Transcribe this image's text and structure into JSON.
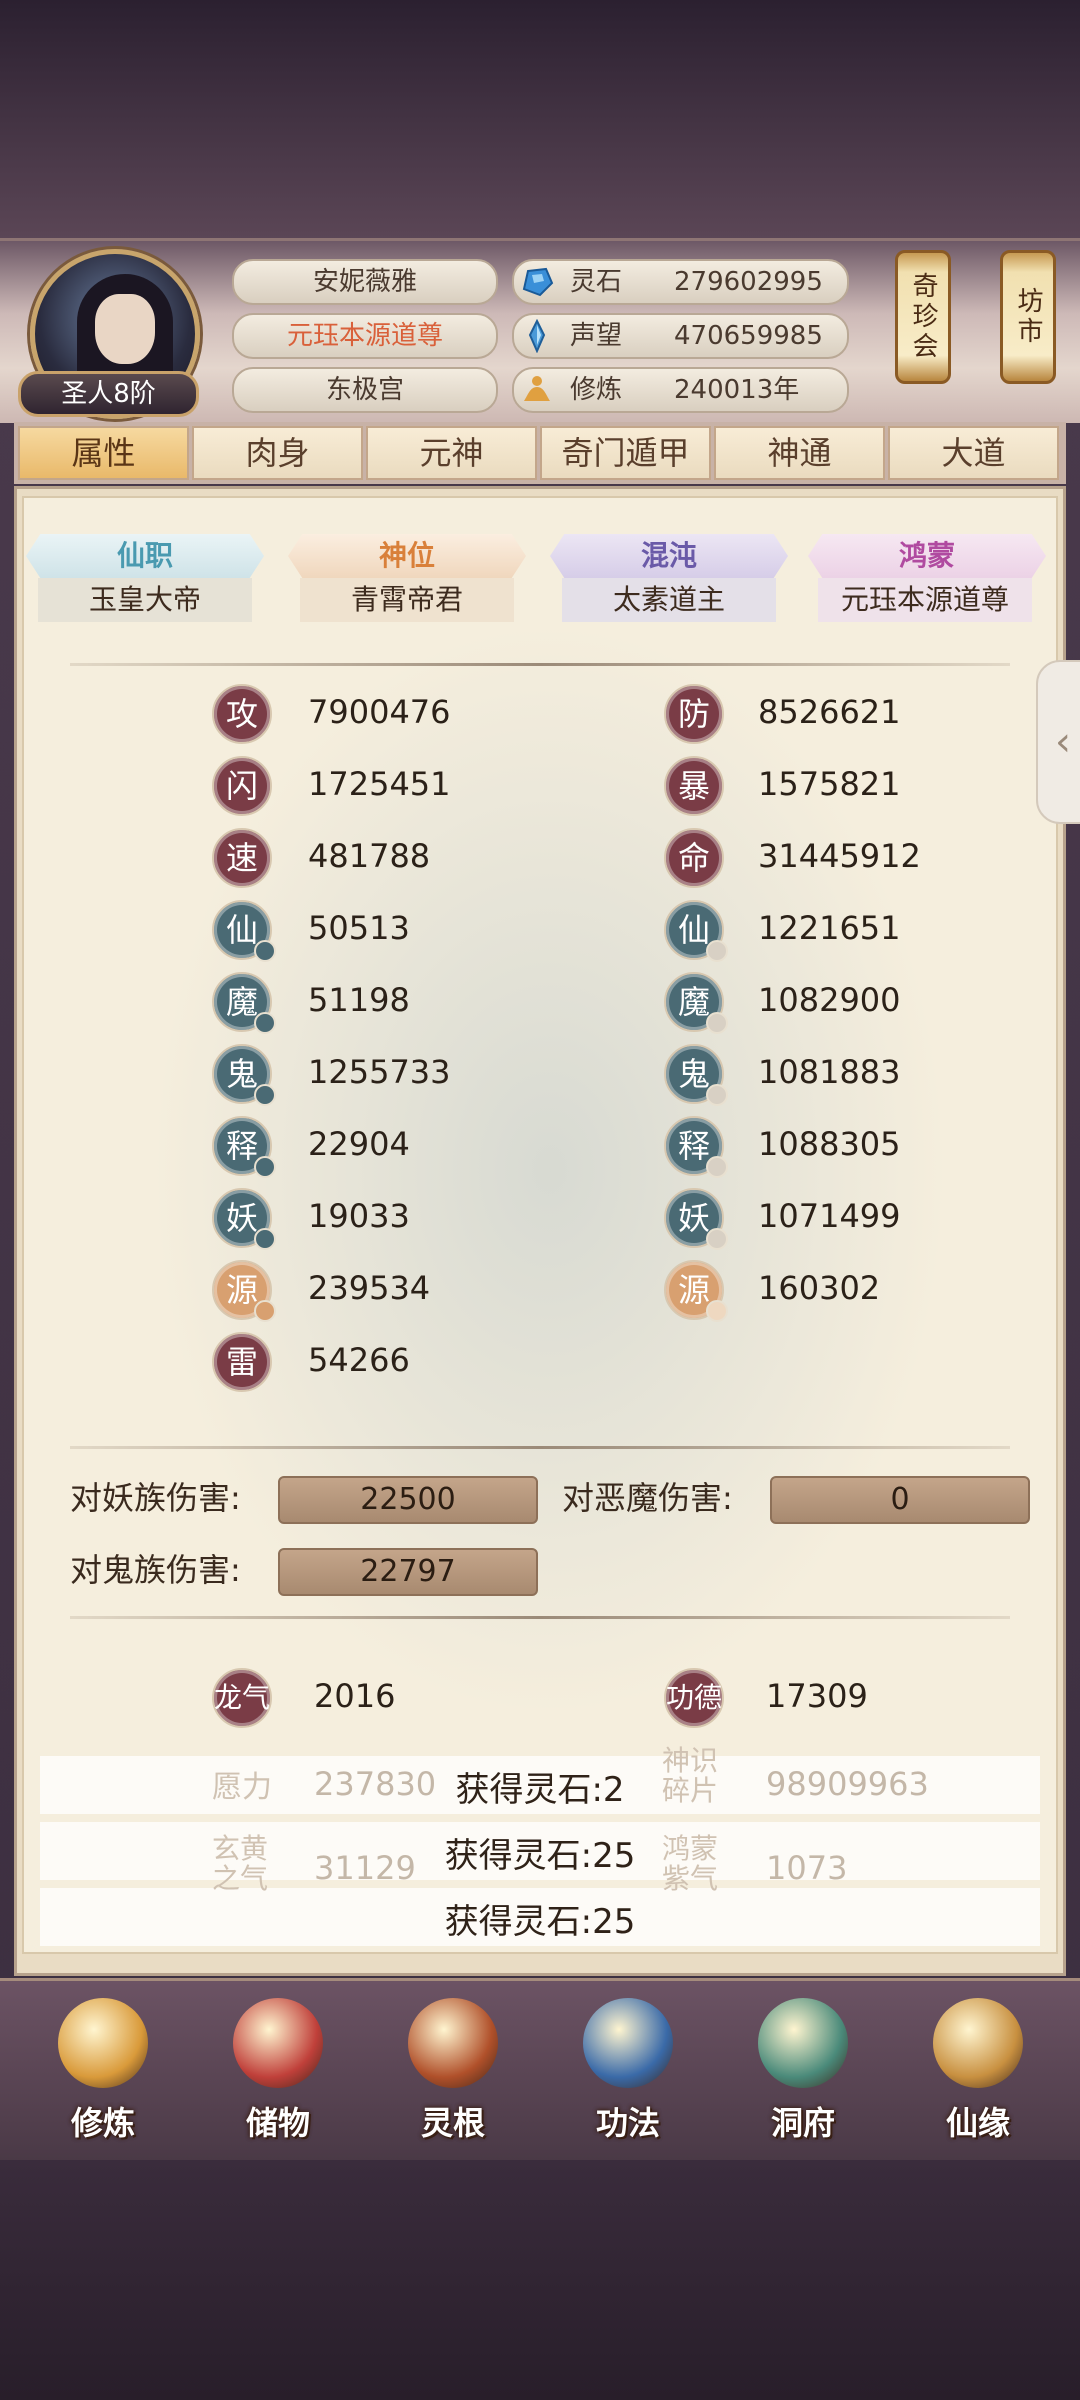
{
  "player": {
    "rank": "圣人8阶",
    "name": "安妮薇雅",
    "title": "元珏本源道尊",
    "palace": "东极宫"
  },
  "resources": [
    {
      "label": "灵石",
      "value": "279602995",
      "icon": "spirit-stone-icon",
      "color": "#3a8fd8"
    },
    {
      "label": "声望",
      "value": "470659985",
      "icon": "prestige-crystal-icon",
      "color": "#4a9ad8"
    },
    {
      "label": "修炼",
      "value": "240013年",
      "icon": "meditation-icon",
      "color": "#e0a040"
    }
  ],
  "lanterns": {
    "treasure_fair": "奇珍会",
    "market": "坊市"
  },
  "tabs": [
    "属性",
    "肉身",
    "元神",
    "奇门遁甲",
    "神通",
    "大道"
  ],
  "ranks": [
    {
      "head": "仙职",
      "value": "玉皇大帝",
      "color": "#4a9ab0"
    },
    {
      "head": "神位",
      "value": "青霄帝君",
      "color": "#d9803a"
    },
    {
      "head": "混沌",
      "value": "太素道主",
      "color": "#6a5aa8"
    },
    {
      "head": "鸿蒙",
      "value": "元珏本源道尊",
      "color": "#b04aa0"
    }
  ],
  "stats_left": [
    {
      "icon": "攻",
      "value": "7900476"
    },
    {
      "icon": "闪",
      "value": "1725451"
    },
    {
      "icon": "速",
      "value": "481788"
    },
    {
      "icon": "仙",
      "value": "50513"
    },
    {
      "icon": "魔",
      "value": "51198"
    },
    {
      "icon": "鬼",
      "value": "1255733"
    },
    {
      "icon": "释",
      "value": "22904"
    },
    {
      "icon": "妖",
      "value": "19033"
    },
    {
      "icon": "源",
      "value": "239534"
    },
    {
      "icon": "雷",
      "value": "54266"
    }
  ],
  "stats_right": [
    {
      "icon": "防",
      "value": "8526621"
    },
    {
      "icon": "暴",
      "value": "1575821"
    },
    {
      "icon": "命",
      "value": "31445912"
    },
    {
      "icon": "仙",
      "value": "1221651"
    },
    {
      "icon": "魔",
      "value": "1082900"
    },
    {
      "icon": "鬼",
      "value": "1081883"
    },
    {
      "icon": "释",
      "value": "1088305"
    },
    {
      "icon": "妖",
      "value": "1071499"
    },
    {
      "icon": "源",
      "value": "160302"
    }
  ],
  "damage": {
    "demon_race_label": "对妖族伤害:",
    "demon_race_value": "22500",
    "evil_demon_label": "对恶魔伤害:",
    "evil_demon_value": "0",
    "ghost_race_label": "对鬼族伤害:",
    "ghost_race_value": "22797"
  },
  "extra": {
    "dragon_label": "龙气",
    "dragon_value": "2016",
    "merit_label": "功德",
    "merit_value": "17309",
    "wish_label": "愿力",
    "wish_value": "237830",
    "shard_label": "神识碎片",
    "shard_value": "98909963",
    "xuanhuang_label": "玄黄之气",
    "xuanhuang_value": "31129",
    "hongmeng_label": "鸿蒙紫气",
    "hongmeng_value": "1073"
  },
  "notifications": [
    "获得灵石:2",
    "获得灵石:25",
    "获得灵石:25"
  ],
  "nav": [
    {
      "label": "修炼",
      "icon": "cultivate-icon",
      "color": "#d99a3a"
    },
    {
      "label": "储物",
      "icon": "storage-bag-icon",
      "color": "#c0403a"
    },
    {
      "label": "灵根",
      "icon": "spirit-root-icon",
      "color": "#b0502a"
    },
    {
      "label": "功法",
      "icon": "technique-book-icon",
      "color": "#3a6aa8"
    },
    {
      "label": "洞府",
      "icon": "cave-mansion-icon",
      "color": "#4a8a7a"
    },
    {
      "label": "仙缘",
      "icon": "gourd-icon",
      "color": "#c89040"
    }
  ],
  "colors": {
    "stat_icon_red": "#7a3c46",
    "stat_icon_teal": "#4a6a74",
    "stat_icon_gold": "#d8a070",
    "tab_active": "#e9b96a"
  }
}
